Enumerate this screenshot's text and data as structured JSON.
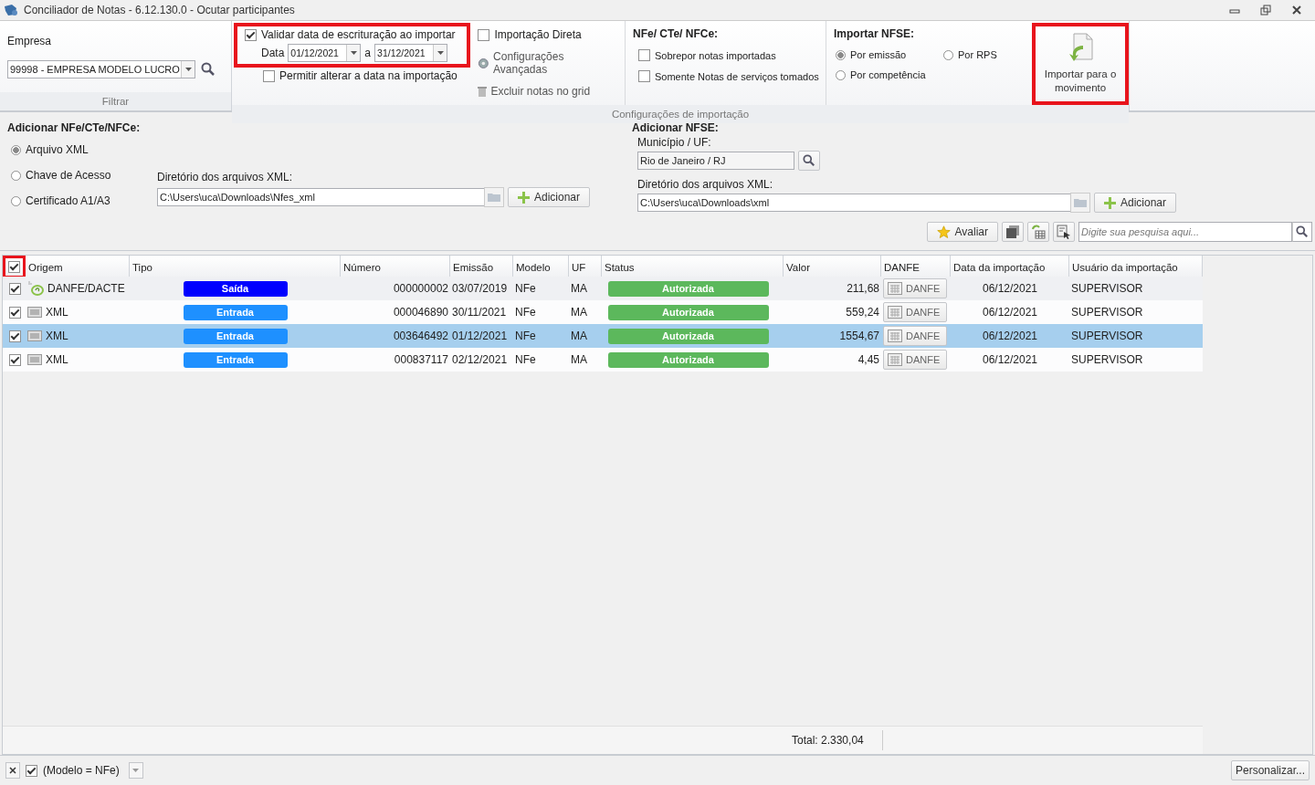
{
  "window": {
    "title": "Conciliador de Notas - 6.12.130.0  -  Ocutar participantes"
  },
  "ribbon": {
    "empresa": {
      "label": "Empresa",
      "value": "99998 - EMPRESA MODELO LUCRO",
      "group_label": "Filtrar"
    },
    "validate": {
      "label": "Validar data de escrituração ao importar",
      "checked": true,
      "highlighted": true,
      "date_label": "Data",
      "date_from": "01/12/2021",
      "between": "a",
      "date_to": "31/12/2021"
    },
    "allow_change": {
      "label": "Permitir alterar a data na importação",
      "checked": false
    },
    "direct_import": {
      "label": "Importação Direta",
      "checked": false
    },
    "advanced": "Configurações Avançadas",
    "delete_notes": "Excluir notas no grid",
    "nfe": {
      "title": "NFe/ CTe/ NFCe:",
      "options": [
        {
          "label": "Sobrepor notas importadas",
          "checked": false
        },
        {
          "label": "Somente Notas de serviços tomados",
          "checked": false
        }
      ]
    },
    "nfse": {
      "title": "Importar NFSE:",
      "options": [
        {
          "label": "Por emissão",
          "selected": true
        },
        {
          "label": "Por RPS",
          "selected": false
        },
        {
          "label": "Por competência",
          "selected": false
        }
      ]
    },
    "group_label": "Configurações de importação",
    "import_button": {
      "label": "Importar para o movimento",
      "highlighted": true
    }
  },
  "add_nfe": {
    "title": "Adicionar NFe/CTe/NFCe:",
    "sources": [
      {
        "label": "Arquivo XML",
        "selected": true
      },
      {
        "label": "Chave de Acesso",
        "selected": false
      },
      {
        "label": "Certificado A1/A3",
        "selected": false
      }
    ],
    "dir_label": "Diretório dos arquivos XML:",
    "dir_value": "C:\\Users\\uca\\Downloads\\Nfes_xml",
    "add_button": "Adicionar"
  },
  "add_nfse": {
    "title": "Adicionar NFSE:",
    "city_label": "Município / UF:",
    "city_value": "Rio de Janeiro / RJ",
    "dir_label": "Diretório dos arquivos XML:",
    "dir_value": "C:\\Users\\uca\\Downloads\\xml",
    "add_button": "Adicionar"
  },
  "toolbar": {
    "evaluate_button": "Avaliar",
    "search": {
      "placeholder": "Digite sua pesquisa aqui..."
    }
  },
  "table": {
    "select_all": {
      "checked": true,
      "highlighted": true
    },
    "columns": [
      "Origem",
      "Tipo",
      "Número",
      "Emissão",
      "Modelo",
      "UF",
      "Status",
      "Valor",
      "DANFE",
      "Data da importação",
      "Usuário da importação"
    ],
    "rows": [
      {
        "checked": true,
        "selected": false,
        "kind": "nfe",
        "origem": "DANFE/DACTE",
        "tipo": {
          "label": "Saída",
          "color": "#0000ff"
        },
        "numero": "000000002",
        "emissao": "03/07/2019",
        "modelo": "NFe",
        "uf": "MA",
        "status": {
          "label": "Autorizada",
          "color": "#5cb85c"
        },
        "valor": "211,68",
        "danfe": "DANFE",
        "data_importacao": "06/12/2021",
        "usuario": "SUPERVISOR"
      },
      {
        "checked": true,
        "selected": false,
        "kind": "xml",
        "origem": "XML",
        "tipo": {
          "label": "Entrada",
          "color": "#1e90ff"
        },
        "numero": "000046890",
        "emissao": "30/11/2021",
        "modelo": "NFe",
        "uf": "MA",
        "status": {
          "label": "Autorizada",
          "color": "#5cb85c"
        },
        "valor": "559,24",
        "danfe": "DANFE",
        "data_importacao": "06/12/2021",
        "usuario": "SUPERVISOR"
      },
      {
        "checked": true,
        "selected": true,
        "kind": "xml",
        "origem": "XML",
        "tipo": {
          "label": "Entrada",
          "color": "#1e90ff"
        },
        "numero": "003646492",
        "emissao": "01/12/2021",
        "modelo": "NFe",
        "uf": "MA",
        "status": {
          "label": "Autorizada",
          "color": "#5cb85c"
        },
        "valor": "1554,67",
        "danfe": "DANFE",
        "data_importacao": "06/12/2021",
        "usuario": "SUPERVISOR"
      },
      {
        "checked": true,
        "selected": false,
        "kind": "xml",
        "origem": "XML",
        "tipo": {
          "label": "Entrada",
          "color": "#1e90ff"
        },
        "numero": "000837117",
        "emissao": "02/12/2021",
        "modelo": "NFe",
        "uf": "MA",
        "status": {
          "label": "Autorizada",
          "color": "#5cb85c"
        },
        "valor": "4,45",
        "danfe": "DANFE",
        "data_importacao": "06/12/2021",
        "usuario": "SUPERVISOR"
      }
    ],
    "total": "Total: 2.330,04"
  },
  "filter_bar": {
    "checked": true,
    "text": "(Modelo = NFe)",
    "customize_button": "Personalizar..."
  }
}
